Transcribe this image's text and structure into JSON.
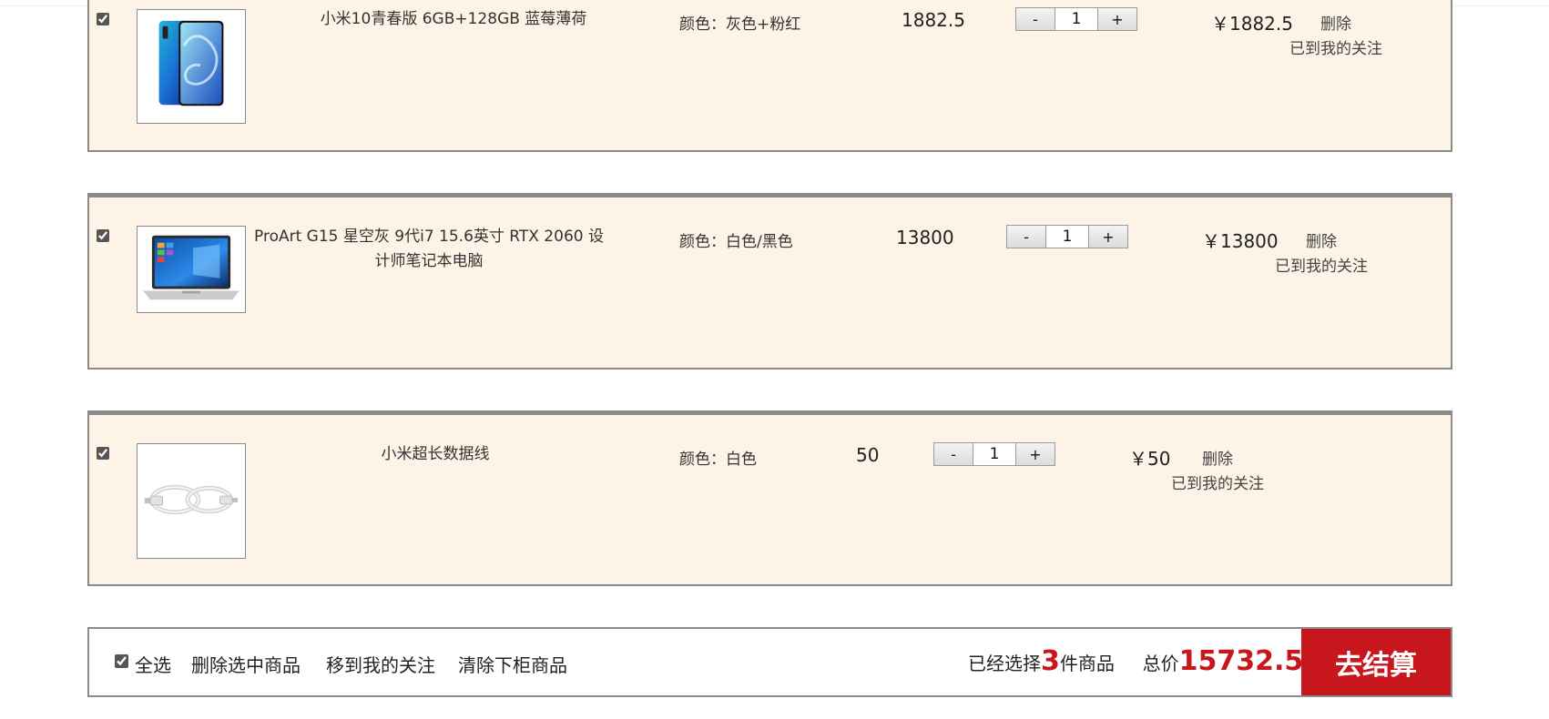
{
  "cart": {
    "items": [
      {
        "name": "小米10青春版 6GB+128GB 蓝莓薄荷",
        "color": "颜色：灰色+粉红",
        "price": "1882.5",
        "quantity": "1",
        "subtotal": "￥1882.5",
        "delete_label": "删除",
        "favorite_label": "已到我的关注",
        "checked": true
      },
      {
        "name": "ProArt G15 星空灰 9代i7 15.6英寸 RTX 2060 设计师笔记本电脑",
        "color": "颜色：白色/黑色",
        "price": "13800",
        "quantity": "1",
        "subtotal": "￥13800",
        "delete_label": "删除",
        "favorite_label": "已到我的关注",
        "checked": true
      },
      {
        "name": "小米超长数据线",
        "color": "颜色：白色",
        "price": "50",
        "quantity": "1",
        "subtotal": "￥50",
        "delete_label": "删除",
        "favorite_label": "已到我的关注",
        "checked": true
      }
    ],
    "stepper": {
      "minus": "-",
      "plus": "+"
    }
  },
  "footer": {
    "select_all": "全选",
    "delete_selected": "删除选中商品",
    "move_to_favorites": "移到我的关注",
    "clear_removed": "清除下柜商品",
    "selected_prefix": "已经选择",
    "selected_count": "3",
    "selected_suffix": "件商品",
    "total_label": "总价",
    "total_value": "15732.5",
    "checkout": "去结算"
  },
  "colors": {
    "accent": "#c8161d",
    "row_bg": "#fdf3e6",
    "border": "#8a8a8a"
  }
}
